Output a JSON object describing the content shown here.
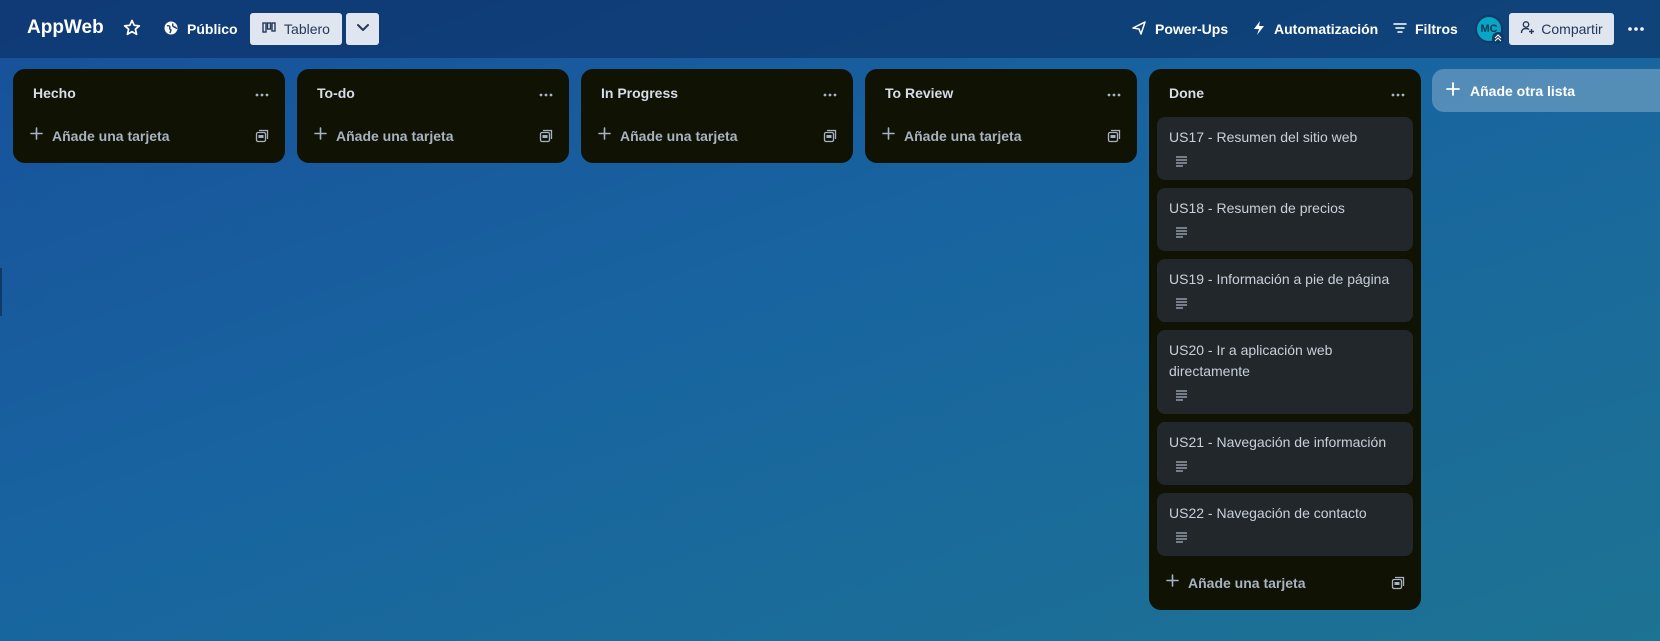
{
  "header": {
    "board_title": "AppWeb",
    "visibility_label": "Público",
    "view_label": "Tablero",
    "powerups_label": "Power-Ups",
    "automation_label": "Automatización",
    "filters_label": "Filtros",
    "avatar_initials": "MC",
    "share_label": "Compartir"
  },
  "lists": [
    {
      "title": "Hecho",
      "add_card_label": "Añade una tarjeta",
      "cards": []
    },
    {
      "title": "To-do",
      "add_card_label": "Añade una tarjeta",
      "cards": []
    },
    {
      "title": "In Progress",
      "add_card_label": "Añade una tarjeta",
      "cards": []
    },
    {
      "title": "To Review",
      "add_card_label": "Añade una tarjeta",
      "cards": []
    },
    {
      "title": "Done",
      "add_card_label": "Añade una tarjeta",
      "cards": [
        {
          "title": "US17 - Resumen del sitio web"
        },
        {
          "title": "US18 - Resumen de precios"
        },
        {
          "title": "US19 - Información a pie de página"
        },
        {
          "title": "US20 - Ir a aplicación web directamente"
        },
        {
          "title": "US21 - Navegación de información"
        },
        {
          "title": "US22 - Navegación de contacto"
        }
      ]
    }
  ],
  "add_list_label": "Añade otra lista",
  "colors": {
    "list_bg": "#101204",
    "card_bg": "#22272b",
    "avatar_bg": "#0aa5c4"
  }
}
